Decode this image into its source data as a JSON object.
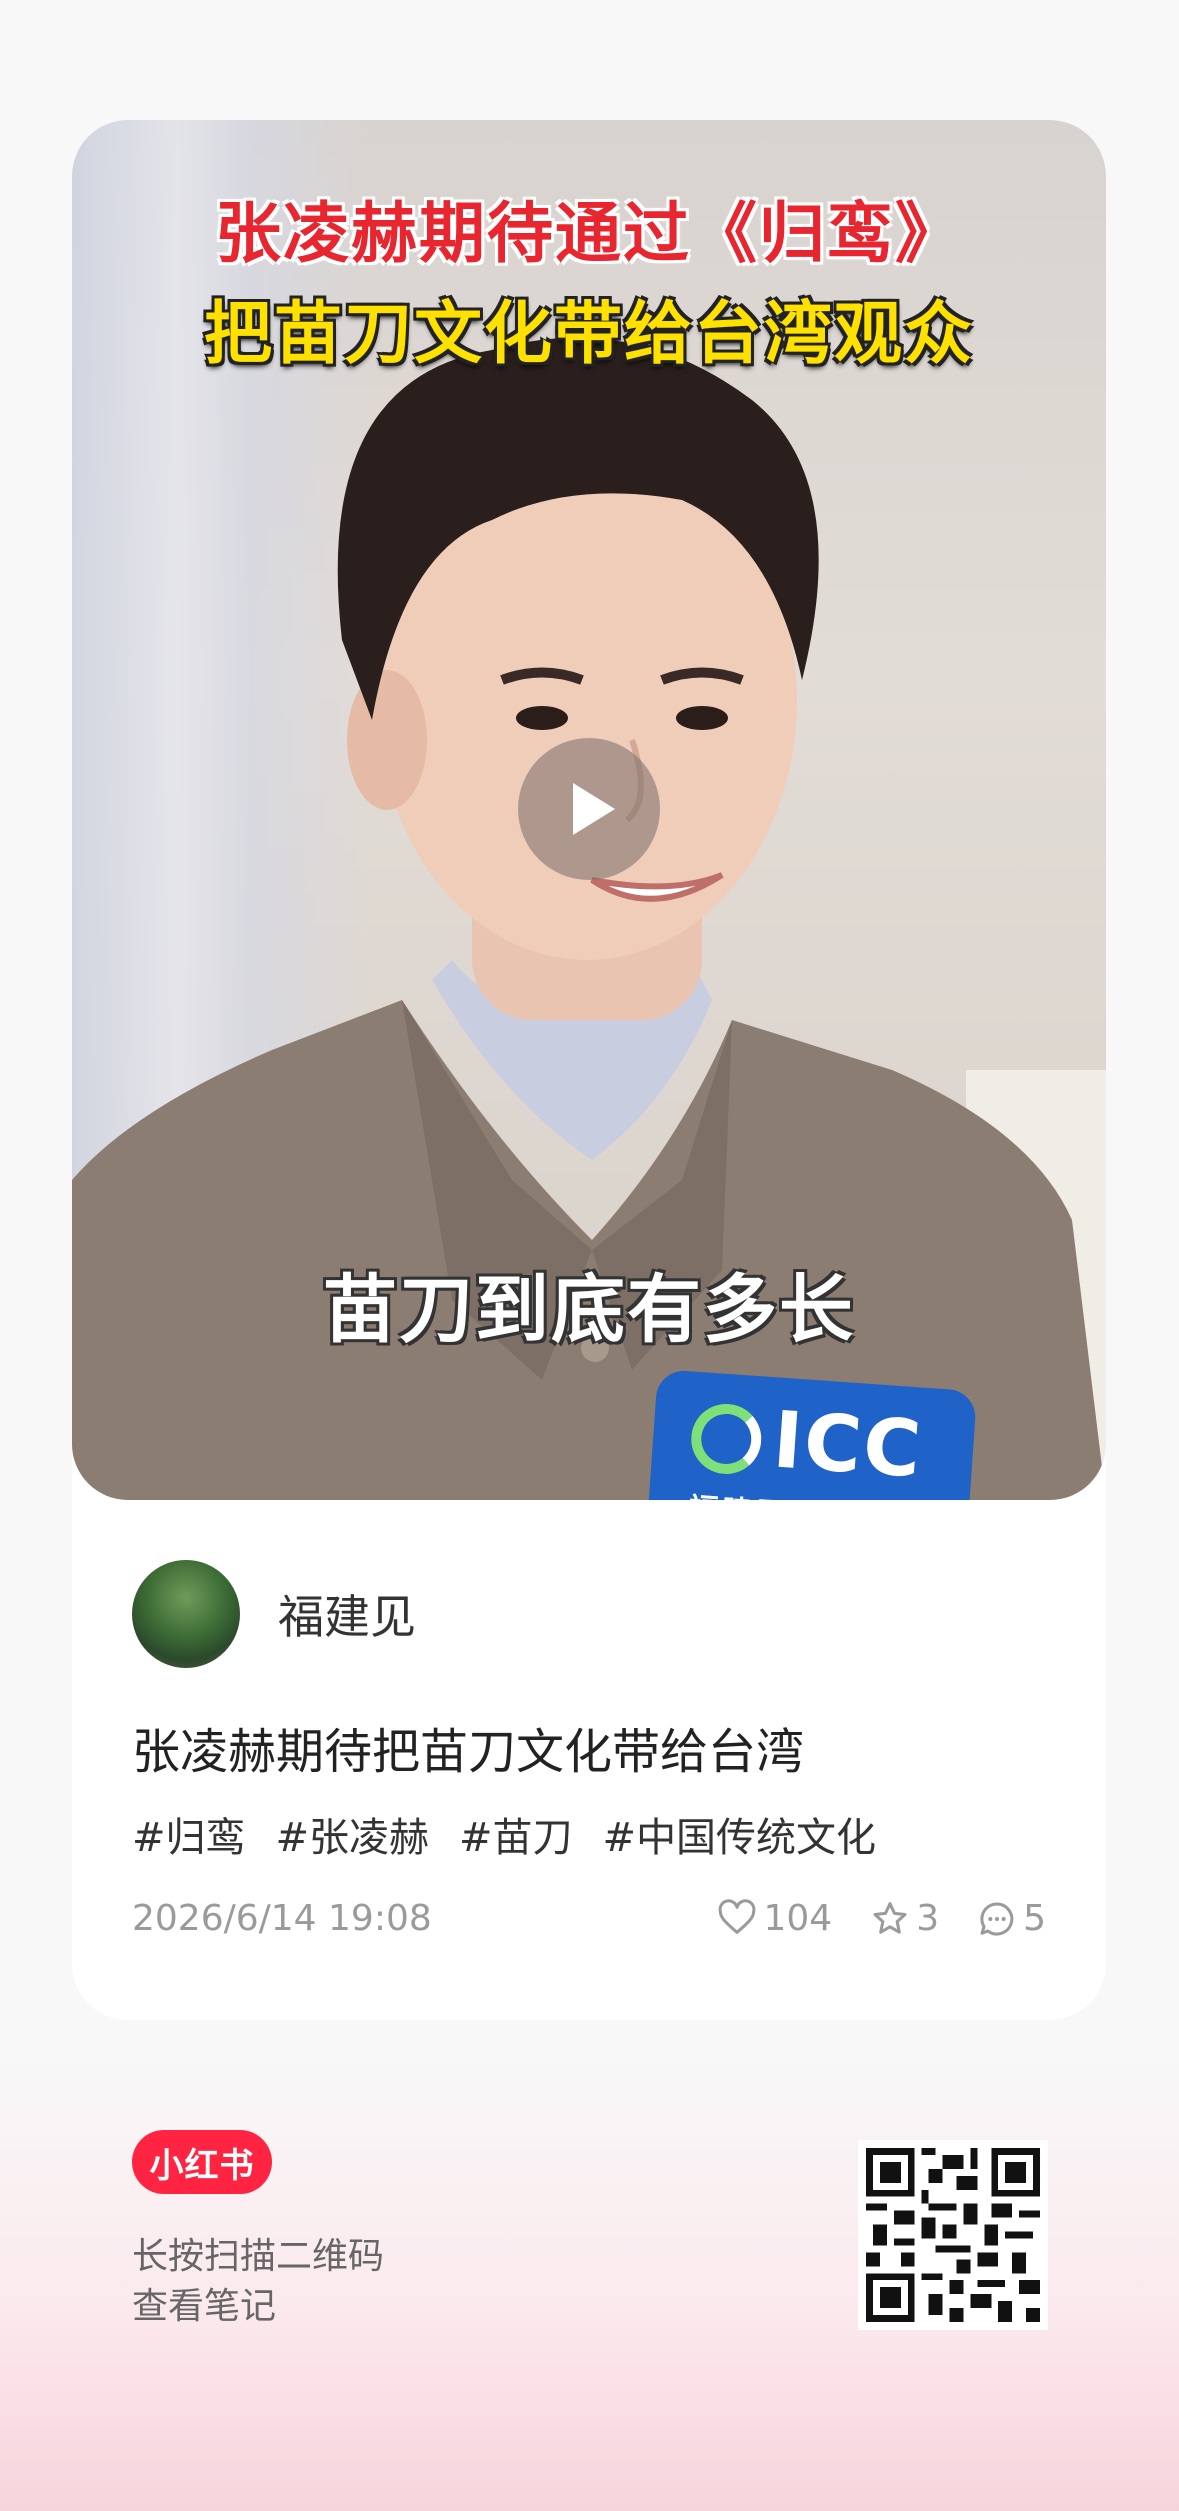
{
  "video": {
    "headline_line1": "张凌赫期待通过《归鸾》",
    "headline_line2": "把苗刀文化带给台湾观众",
    "subtitle": "苗刀到底有多长",
    "mic_label": "ICC",
    "mic_sublabel": "福建国际传"
  },
  "author": {
    "name": "福建见"
  },
  "post": {
    "title": "张凌赫期待把苗刀文化带给台湾",
    "tags": [
      "#归鸾",
      "#张凌赫",
      "#苗刀",
      "#中国传统文化"
    ],
    "date": "2026/6/14 19:08",
    "likes": "104",
    "favorites": "3",
    "comments": "5"
  },
  "footer": {
    "brand": "小红书",
    "line1": "长按扫描二维码",
    "line2": "查看笔记"
  },
  "colors": {
    "brand": "#ff2442",
    "headline_red": "#e8262f",
    "headline_yellow": "#ffe100"
  }
}
